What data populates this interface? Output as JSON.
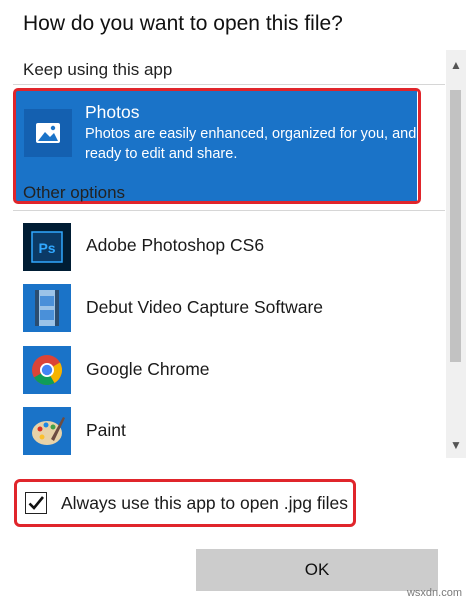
{
  "dialog": {
    "title": "How do you want to open this file?"
  },
  "sections": {
    "keep_using": "Keep using this app",
    "other_options": "Other options"
  },
  "selected_app": {
    "name": "Photos",
    "description_line1": "Photos are easily enhanced, organized for you, and",
    "description_line2": "ready to edit and share.",
    "icon": "photos-icon"
  },
  "other_apps": [
    {
      "name": "Adobe Photoshop CS6",
      "icon": "photoshop-icon"
    },
    {
      "name": "Debut Video Capture Software",
      "icon": "film-strip-icon"
    },
    {
      "name": "Google Chrome",
      "icon": "chrome-icon"
    },
    {
      "name": "Paint",
      "icon": "paint-palette-icon"
    },
    {
      "name": "",
      "icon": "paint-3d-icon"
    }
  ],
  "checkbox": {
    "label": "Always use this app to open .jpg files",
    "checked": true
  },
  "buttons": {
    "ok_label": "OK"
  },
  "watermark": "wsxdn.com",
  "colors": {
    "selection": "#1a73c8",
    "highlight": "#e0252b",
    "button": "#cccccc"
  }
}
